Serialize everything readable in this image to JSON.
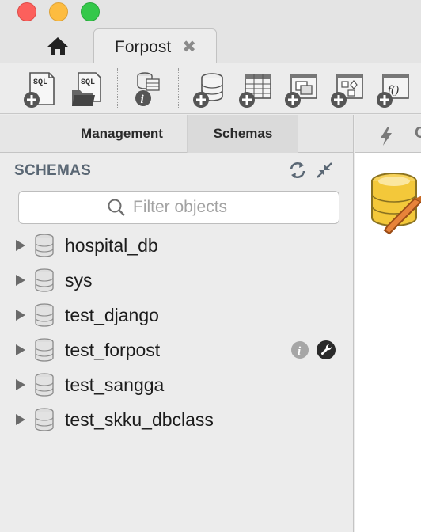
{
  "window": {
    "tab_title": "Forpost",
    "tab_close_glyph": "✖",
    "tabs": [
      "home-icon",
      "Forpost"
    ]
  },
  "toolbar": {
    "buttons": [
      {
        "icon": "new-sql-tab-icon"
      },
      {
        "icon": "open-sql-script-icon"
      },
      {
        "icon": "object-inspector-icon"
      },
      {
        "icon": "create-schema-icon"
      },
      {
        "icon": "create-table-icon"
      },
      {
        "icon": "create-view-icon"
      },
      {
        "icon": "create-procedure-icon"
      },
      {
        "icon": "create-function-icon"
      }
    ]
  },
  "sidebar": {
    "tabs": {
      "management": "Management",
      "schemas": "Schemas"
    },
    "header": "SCHEMAS",
    "filter": {
      "placeholder": "Filter objects",
      "value": ""
    },
    "schemas": [
      "hospital_db",
      "sys",
      "test_django",
      "test_forpost",
      "test_sangga",
      "test_skku_dbclass"
    ],
    "hovered_schema_index": 3
  },
  "right_panel": {
    "tab_partial_text": "C"
  },
  "colors": {
    "accent_blue": "#1f6fbf",
    "db_gold": "#f3c83a",
    "header_text": "#5a6774"
  }
}
